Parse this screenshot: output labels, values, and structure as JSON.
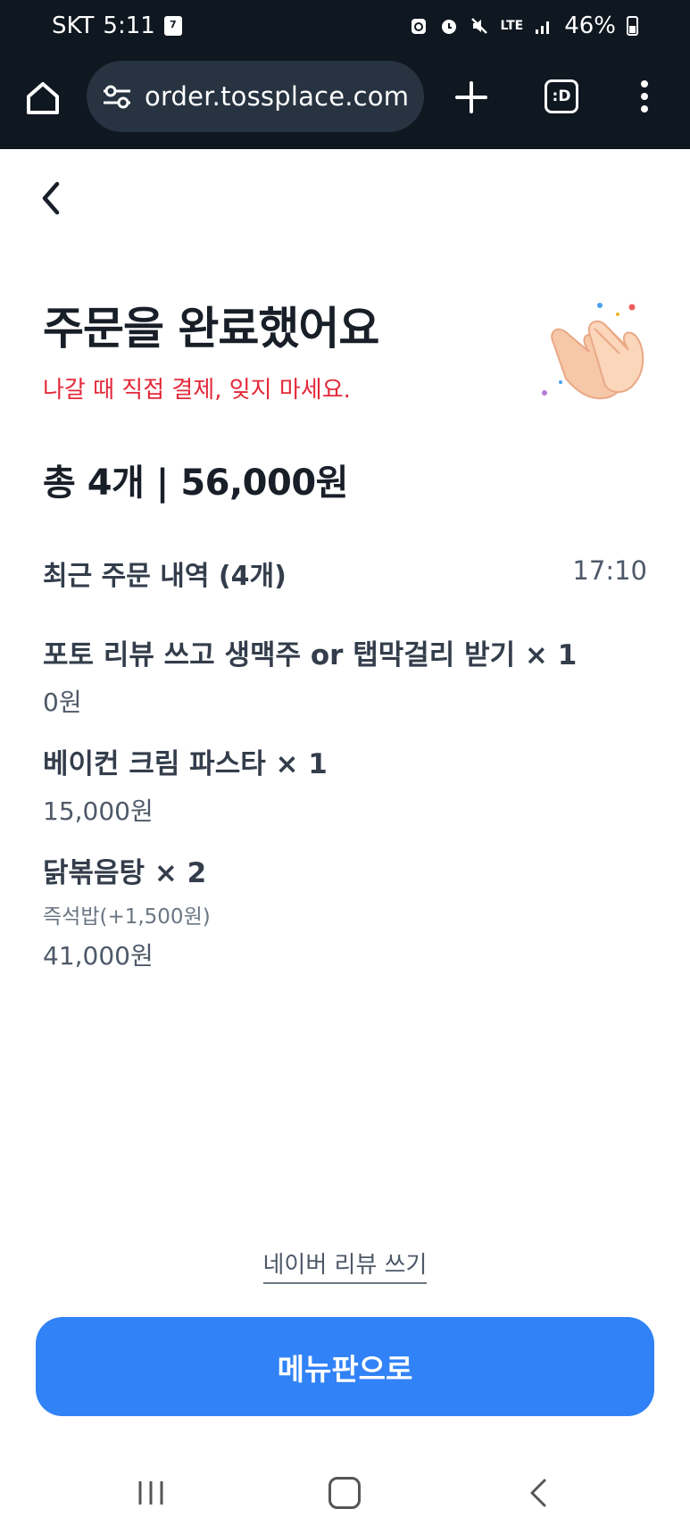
{
  "status_bar": {
    "carrier": "SKT",
    "time": "5:11",
    "calendar_day": "7",
    "network": "LTE",
    "battery": "46%"
  },
  "browser": {
    "url": "order.tossplace.com",
    "tabs_label": ":D"
  },
  "page": {
    "title": "주문을 완료했어요",
    "subtitle": "나갈 때 직접 결제, 잊지 마세요.",
    "total": "총 4개 | 56,000원",
    "recent_orders": {
      "title": "최근 주문 내역 (4개)",
      "time": "17:10",
      "items": [
        {
          "name": "포토 리뷰 쓰고 생맥주 or 탭막걸리  받기 × 1",
          "option": "",
          "price": "0원"
        },
        {
          "name": "베이컨 크림 파스타 × 1",
          "option": "",
          "price": "15,000원"
        },
        {
          "name": "닭볶음탕 × 2",
          "option": "즉석밥(+1,500원)",
          "price": "41,000원"
        }
      ]
    },
    "naver_review_link": "네이버 리뷰 쓰기",
    "menu_button": "메뉴판으로"
  },
  "colors": {
    "accent": "#3182f6",
    "warning": "#e42939",
    "chrome_bg": "#0f1720"
  },
  "icons": [
    "home-icon",
    "tune-icon",
    "plus-icon",
    "more-vert-icon",
    "back-arrow-icon",
    "clapping-hands-icon",
    "nav-recent-icon",
    "nav-home-icon",
    "nav-back-icon"
  ]
}
